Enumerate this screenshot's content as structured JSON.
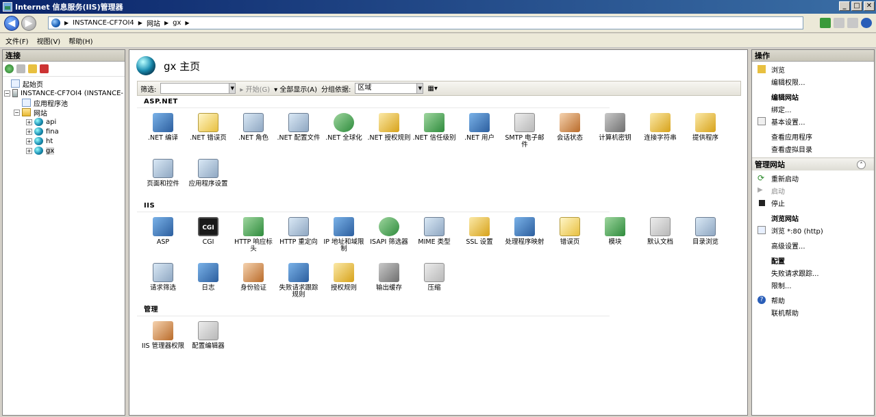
{
  "window": {
    "title": "Internet 信息服务(IIS)管理器"
  },
  "address": {
    "crumbs": [
      "INSTANCE-CF7OI4",
      "网站",
      "gx"
    ]
  },
  "menu": [
    "文件(F)",
    "视图(V)",
    "帮助(H)"
  ],
  "left": {
    "header": "连接",
    "tree": [
      {
        "label": "起始页",
        "level": 0
      },
      {
        "label": "INSTANCE-CF7OI4 (INSTANCE-",
        "level": 0
      },
      {
        "label": "应用程序池",
        "level": 1
      },
      {
        "label": "网站",
        "level": 1
      },
      {
        "label": "api",
        "level": 2
      },
      {
        "label": "fina",
        "level": 2
      },
      {
        "label": "ht",
        "level": 2
      },
      {
        "label": "gx",
        "level": 2
      }
    ]
  },
  "center": {
    "title": "gx 主页",
    "filter": {
      "label": "筛选:",
      "start": "开始(G)",
      "showall": "全部显示(A)",
      "groupby": "分组依据:",
      "groupval": "区域"
    },
    "groups": [
      {
        "name": "ASP.NET",
        "items": [
          ".NET 编译",
          ".NET 错误页",
          ".NET 角色",
          ".NET 配置文件",
          ".NET 全球化",
          ".NET 授权规则",
          ".NET 信任级别",
          ".NET 用户",
          "SMTP 电子邮件",
          "会话状态",
          "计算机密钥",
          "连接字符串",
          "提供程序",
          "页面和控件",
          "应用程序设置"
        ]
      },
      {
        "name": "IIS",
        "items": [
          "ASP",
          "CGI",
          "HTTP 响应标头",
          "HTTP 重定向",
          "IP 地址和域限制",
          "ISAPI 筛选器",
          "MIME 类型",
          "SSL 设置",
          "处理程序映射",
          "错误页",
          "模块",
          "默认文档",
          "目录浏览",
          "请求筛选",
          "日志",
          "身份验证",
          "失败请求跟踪规则",
          "授权规则",
          "输出缓存",
          "压缩"
        ]
      },
      {
        "name": "管理",
        "items": [
          "IIS 管理器权限",
          "配置编辑器"
        ]
      }
    ]
  },
  "right": {
    "header": "操作",
    "browse": "浏览",
    "edit_perm": "编辑权限...",
    "edit_site": "编辑网站",
    "bind": "绑定...",
    "basic": "基本设置...",
    "view_apps": "查看应用程序",
    "view_vdirs": "查看虚拟目录",
    "manage_site": "管理网站",
    "restart": "重新启动",
    "start": "启动",
    "stop": "停止",
    "browse_site": "浏览网站",
    "browse_80": "浏览 *:80 (http)",
    "advanced": "高级设置...",
    "config": "配置",
    "failed_trace": "失败请求跟踪...",
    "limits": "限制...",
    "help": "帮助",
    "online_help": "联机帮助"
  }
}
